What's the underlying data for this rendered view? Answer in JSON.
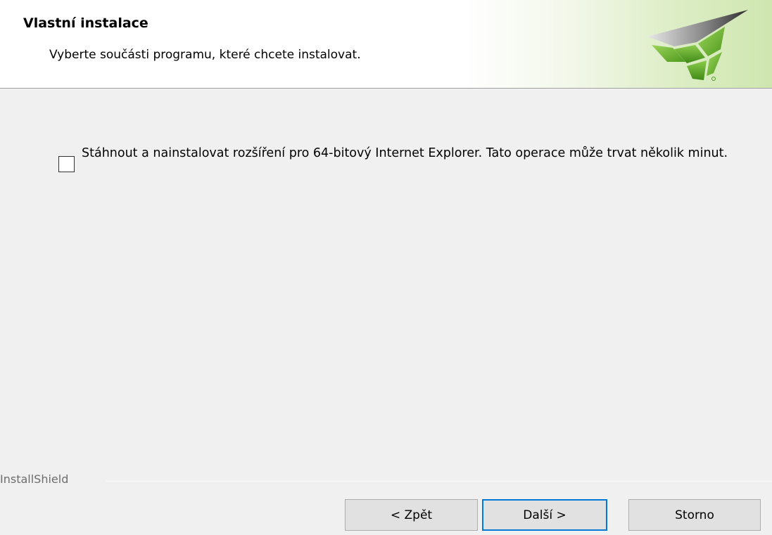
{
  "header": {
    "title": "Vlastní instalace",
    "subtitle": "Vyberte součásti programu, které chcete instalovat.",
    "logo_icon": "installshield-logo-icon",
    "accent_color": "#7dc242"
  },
  "options": [
    {
      "label": "Stáhnout a nainstalovat rozšíření pro 64-bitový Internet Explorer. Tato operace může trvat několik minut.",
      "checked": false
    }
  ],
  "footer": {
    "brand": "InstallShield",
    "back_label": "< Zpět",
    "next_label": "Další >",
    "cancel_label": "Storno"
  }
}
